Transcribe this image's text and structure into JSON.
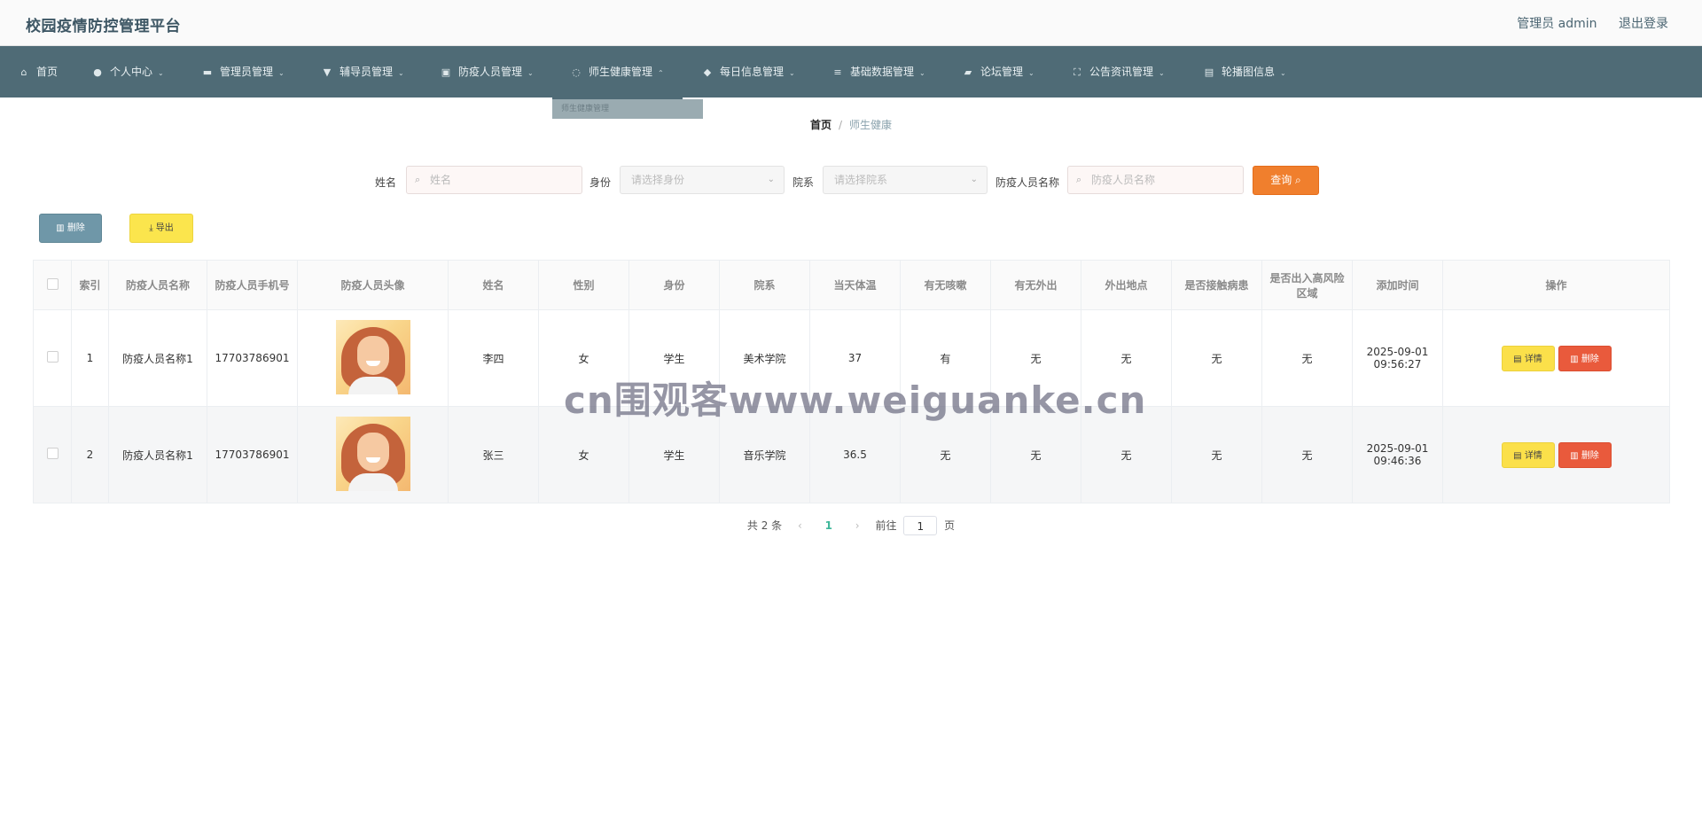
{
  "header": {
    "title": "校园疫情防控管理平台",
    "user": "管理员 admin",
    "logout": "退出登录"
  },
  "nav": {
    "items": [
      {
        "label": "首页",
        "icon": "home-icon",
        "glyph": "⌂",
        "arrow": ""
      },
      {
        "label": "个人中心",
        "icon": "user-icon",
        "glyph": "●",
        "arrow": "⌄"
      },
      {
        "label": "管理员管理",
        "icon": "admin-icon",
        "glyph": "▬",
        "arrow": "⌄"
      },
      {
        "label": "辅导员管理",
        "icon": "counselor-icon",
        "glyph": "▼",
        "arrow": "⌄"
      },
      {
        "label": "防疫人员管理",
        "icon": "chart-icon",
        "glyph": "▣",
        "arrow": "⌄"
      },
      {
        "label": "师生健康管理",
        "icon": "power-icon",
        "glyph": "◌",
        "arrow": "⌃"
      },
      {
        "label": "每日信息管理",
        "icon": "location-icon",
        "glyph": "◆",
        "arrow": "⌄"
      },
      {
        "label": "基础数据管理",
        "icon": "list-icon",
        "glyph": "≡",
        "arrow": "⌄"
      },
      {
        "label": "论坛管理",
        "icon": "ticket-icon",
        "glyph": "▰",
        "arrow": "⌄"
      },
      {
        "label": "公告资讯管理",
        "icon": "fullscreen-icon",
        "glyph": "⛶",
        "arrow": "⌄"
      },
      {
        "label": "轮播图信息",
        "icon": "clipboard-icon",
        "glyph": "▤",
        "arrow": "⌄"
      }
    ],
    "submenu_item": "师生健康管理"
  },
  "breadcrumb": {
    "home": "首页",
    "separator": "/",
    "current": "师生健康"
  },
  "search": {
    "name_label": "姓名",
    "name_placeholder": "姓名",
    "identity_label": "身份",
    "identity_placeholder": "请选择身份",
    "dept_label": "院系",
    "dept_placeholder": "请选择院系",
    "staff_label": "防疫人员名称",
    "staff_placeholder": "防疫人员名称",
    "query_button": "查询"
  },
  "actions": {
    "delete_label": "删除",
    "export_label": "导出"
  },
  "table": {
    "headers": [
      "",
      "索引",
      "防疫人员名称",
      "防疫人员手机号",
      "防疫人员头像",
      "姓名",
      "性别",
      "身份",
      "院系",
      "当天体温",
      "有无咳嗽",
      "有无外出",
      "外出地点",
      "是否接触病患",
      "是否出入高风险区域",
      "添加时间",
      "操作"
    ],
    "rows": [
      {
        "index": "1",
        "staff_name": "防疫人员名称1",
        "phone": "17703786901",
        "name": "李四",
        "gender": "女",
        "identity": "学生",
        "dept": "美术学院",
        "temperature": "37",
        "cough": "有",
        "outing": "无",
        "outing_place": "无",
        "contact": "无",
        "high_risk": "无",
        "added": "2025-09-01 09:56:27",
        "detail": "详情",
        "delete": "删除"
      },
      {
        "index": "2",
        "staff_name": "防疫人员名称1",
        "phone": "17703786901",
        "name": "张三",
        "gender": "女",
        "identity": "学生",
        "dept": "音乐学院",
        "temperature": "36.5",
        "cough": "无",
        "outing": "无",
        "outing_place": "无",
        "contact": "无",
        "high_risk": "无",
        "added": "2025-09-01 09:46:36",
        "detail": "详情",
        "delete": "删除"
      }
    ]
  },
  "pagination": {
    "total": "共 2 条",
    "current_page": "1",
    "goto_prefix": "前往",
    "goto_value": "1",
    "goto_suffix": "页"
  },
  "watermark": "cn围观客www.weiguanke.cn",
  "colors": {
    "nav_bg": "#4f6b76",
    "accent_orange": "#f07f2d",
    "accent_yellow": "#fbe54d",
    "accent_red": "#e95a3c",
    "page_active": "#3fb79a"
  }
}
